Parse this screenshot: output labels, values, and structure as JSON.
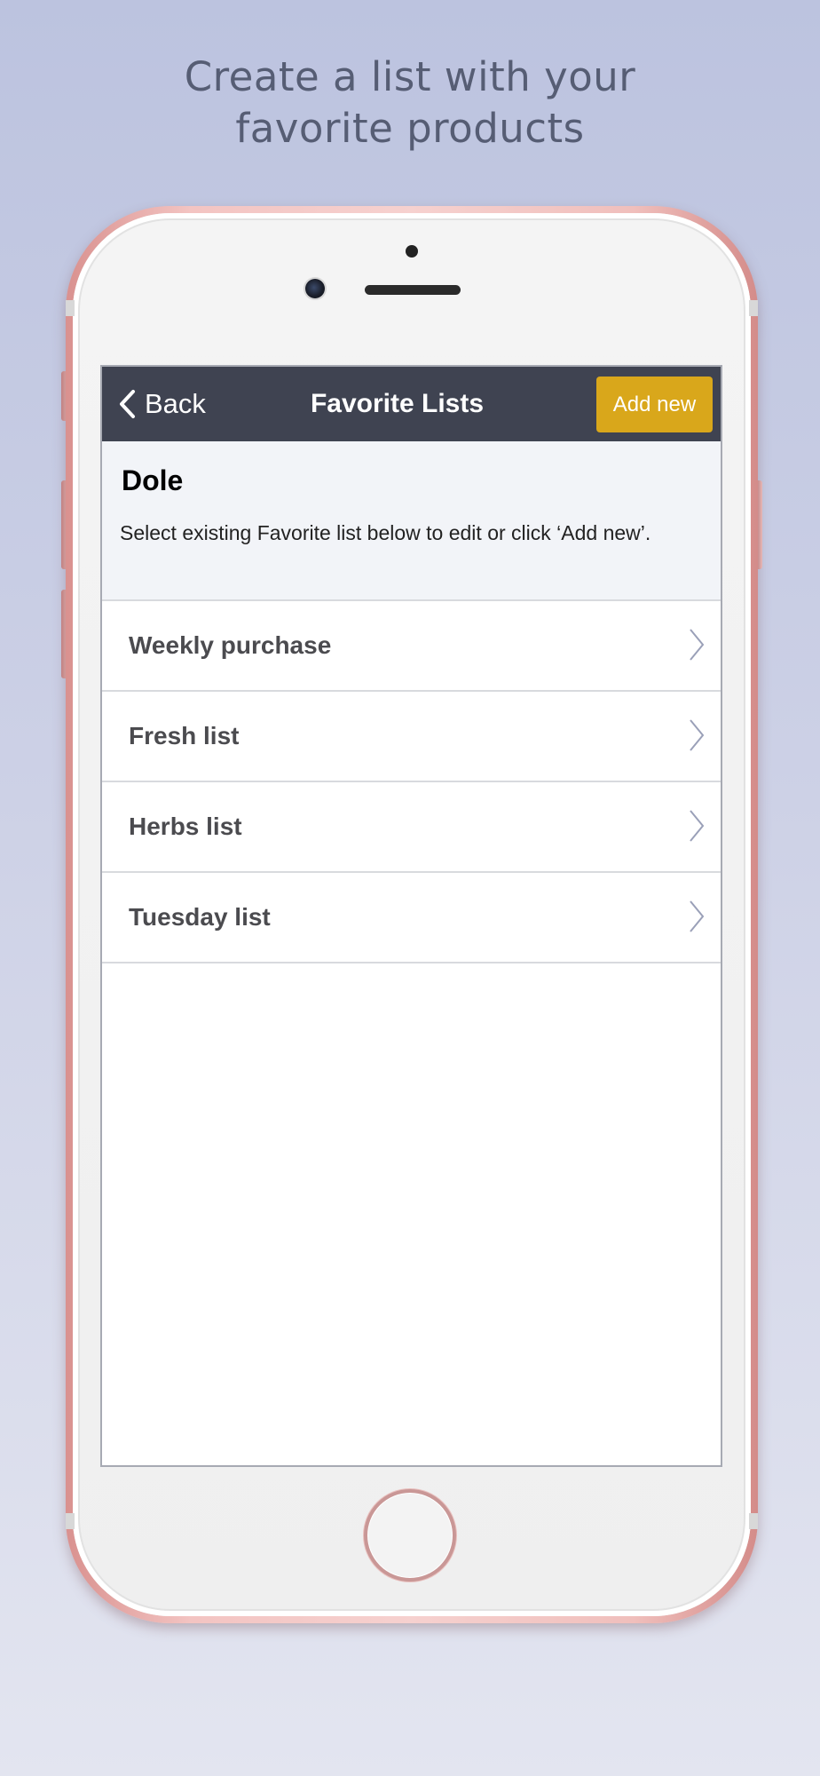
{
  "headline": {
    "line1": "Create a list with your",
    "line2": "favorite products"
  },
  "navbar": {
    "back_label": "Back",
    "title": "Favorite Lists",
    "add_label": "Add new"
  },
  "info": {
    "store_name": "Dole",
    "instructions": "Select existing Favorite list below to edit or click ‘Add new’."
  },
  "lists": [
    {
      "label": "Weekly purchase"
    },
    {
      "label": "Fresh list"
    },
    {
      "label": "Herbs list"
    },
    {
      "label": "Tuesday list"
    }
  ],
  "colors": {
    "navbar": "#3f4351",
    "accent": "#d9a71b",
    "background": "#bcc3df"
  }
}
